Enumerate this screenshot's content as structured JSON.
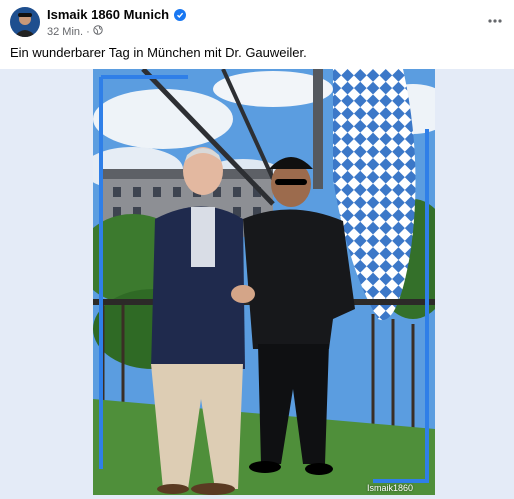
{
  "post": {
    "author_name": "Ismaik 1860 Munich",
    "time": "32 Min.",
    "separator": "·",
    "caption": "Ein wunderbarer Tag in München mit Dr. Gauweiler.",
    "photo_watermark": "Ismaik1860",
    "icons": {
      "verified": "verified-badge-icon",
      "audience": "globe-icon",
      "more": "more-options-icon"
    },
    "colors": {
      "verified": "#1877f2",
      "meta_text": "#65676b",
      "frame_blue": "#2f7fe8"
    }
  }
}
